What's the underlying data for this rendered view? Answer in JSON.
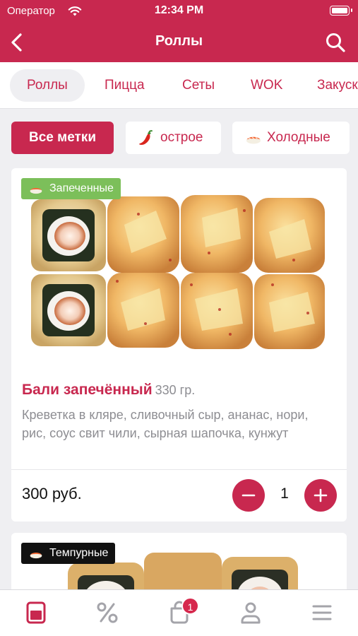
{
  "status": {
    "carrier": "Оператор",
    "time": "12:34 PM"
  },
  "nav": {
    "title": "Роллы"
  },
  "categories": [
    {
      "label": "Роллы",
      "active": true
    },
    {
      "label": "Пицца"
    },
    {
      "label": "Сеты"
    },
    {
      "label": "WOK"
    },
    {
      "label": "Закуски"
    }
  ],
  "filters": [
    {
      "label": "Все метки",
      "active": true
    },
    {
      "label": "острое",
      "icon": "chili-pepper-icon"
    },
    {
      "label": "Холодные",
      "icon": "sushi-icon"
    }
  ],
  "products": [
    {
      "badge": "Запеченные",
      "badge_icon": "sushi-icon",
      "badge_color": "#7cbf5a",
      "name": "Бали запечённый",
      "weight": "330 гр.",
      "description": "Креветка в кляре, сливочный сыр, ананас, нори, рис, соус свит чили, сырная шапочка, кунжут",
      "price": "300 руб.",
      "quantity": "1"
    },
    {
      "badge": "Темпурные",
      "badge_icon": "sushi-icon",
      "badge_color": "#111111"
    }
  ],
  "tabbar": {
    "items": [
      "menu-icon",
      "percent-icon",
      "cart-icon",
      "profile-icon",
      "hamburger-icon"
    ],
    "cart_count": "1"
  },
  "colors": {
    "accent": "#c8284f",
    "background": "#efeff2",
    "badge_green": "#7cbf5a"
  }
}
